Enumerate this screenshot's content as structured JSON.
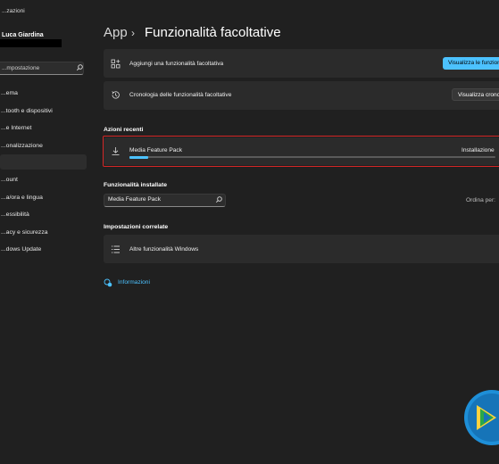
{
  "window": {
    "title": "...zazioni"
  },
  "user": {
    "name": "Luca Giardina"
  },
  "sidebar": {
    "search_placeholder": "...mpostazione",
    "items": [
      {
        "label": "...ema"
      },
      {
        "label": "...tooth e dispositivi"
      },
      {
        "label": "...e Internet"
      },
      {
        "label": "...onalizzazione"
      },
      {
        "label": ""
      },
      {
        "label": "...ount"
      },
      {
        "label": "...a/ora e lingua"
      },
      {
        "label": "...essibilità"
      },
      {
        "label": "...acy e sicurezza"
      },
      {
        "label": "...dows Update"
      }
    ]
  },
  "header": {
    "breadcrumb_root": "App",
    "breadcrumb_sep": "›",
    "title": "Funzionalità facoltative"
  },
  "cards": {
    "add": {
      "label": "Aggiungi una funzionalità facoltativa",
      "button": "Visualizza le funzionalità"
    },
    "history": {
      "label": "Cronologia delle funzionalità facoltative",
      "button": "Visualizza cronologia"
    }
  },
  "recent": {
    "section_title": "Azioni recenti",
    "item_name": "Media Feature Pack",
    "status": "Installazione",
    "progress": 0.05
  },
  "installed": {
    "section_title": "Funzionalità installate",
    "search_value": "Media Feature Pack",
    "sort_label": "Ordina per:"
  },
  "related": {
    "section_title": "Impostazioni correlate",
    "item_label": "Altre funzionalità Windows"
  },
  "info": {
    "label": "Informazioni"
  },
  "colors": {
    "accent": "#4cc2ff",
    "highlight": "#d42626",
    "background": "#202020",
    "card": "#2b2b2b"
  }
}
